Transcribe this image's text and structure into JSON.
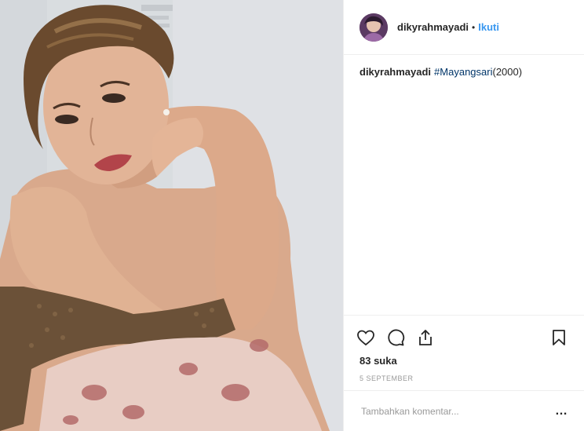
{
  "post": {
    "username": "dikyrahmayadi",
    "follow_separator": "•",
    "follow_label": "Ikuti",
    "caption": {
      "username": "dikyrahmayadi",
      "hashtag": "#Mayangsari",
      "text": "(2000)"
    },
    "actions": {
      "like_icon": "heart-icon",
      "comment_icon": "comment-bubble-icon",
      "share_icon": "share-upload-icon",
      "save_icon": "bookmark-icon"
    },
    "likes_text": "83 suka",
    "date_text": "5 SEPTEMBER",
    "comment_placeholder": "Tambahkan komentar...",
    "more_icon": "…"
  },
  "colors": {
    "link": "#3897f0",
    "hashtag": "#003569",
    "border": "#efefef",
    "muted": "#999999"
  }
}
